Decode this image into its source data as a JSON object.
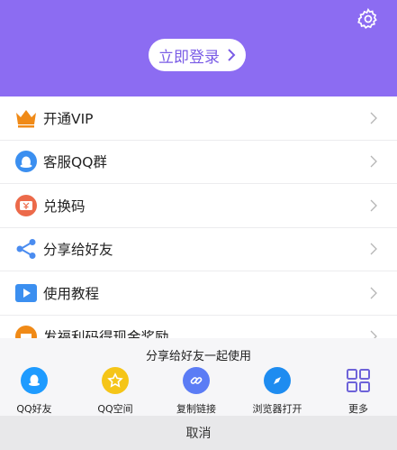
{
  "header": {
    "login_label": "立即登录",
    "bg_color": "#8c6cf2"
  },
  "menu": {
    "items": [
      {
        "label": "开通VIP",
        "icon": "crown-icon"
      },
      {
        "label": "客服QQ群",
        "icon": "qq-icon"
      },
      {
        "label": "兑换码",
        "icon": "ticket-icon"
      },
      {
        "label": "分享给好友",
        "icon": "share-icon"
      },
      {
        "label": "使用教程",
        "icon": "play-icon"
      },
      {
        "label": "发福利码得现金奖励",
        "icon": "gift-icon"
      }
    ]
  },
  "share": {
    "title": "分享给好友一起使用",
    "items": [
      {
        "label": "QQ好友",
        "icon": "qq-friend-icon",
        "color": "#1e9bff"
      },
      {
        "label": "QQ空间",
        "icon": "qzone-star-icon",
        "color": "#f5c518"
      },
      {
        "label": "复制链接",
        "icon": "link-icon",
        "color": "#5b7cf5"
      },
      {
        "label": "浏览器打开",
        "icon": "compass-icon",
        "color": "#1e8cf0"
      },
      {
        "label": "更多",
        "icon": "grid-icon",
        "color": "#6e63d9"
      }
    ],
    "cancel_label": "取消"
  }
}
